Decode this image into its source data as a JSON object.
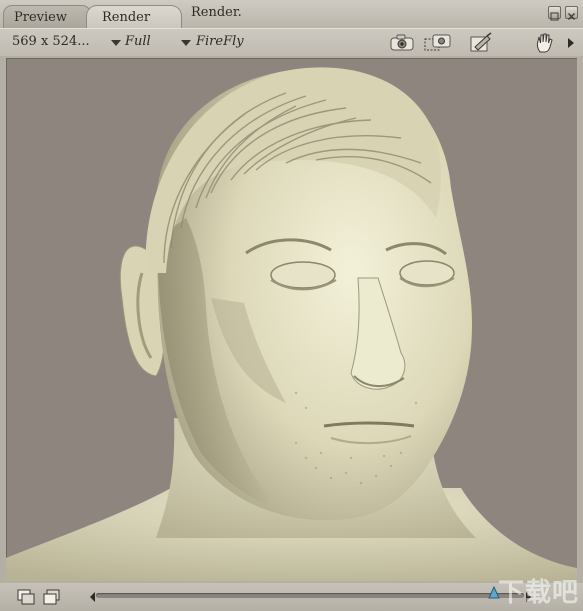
{
  "tabs": [
    {
      "label": "Preview",
      "active": false
    },
    {
      "label": "Render",
      "active": true
    }
  ],
  "document_title": "Render.",
  "toolbar": {
    "dimensions": "569 x 524...",
    "resolution_value": "Full",
    "renderer_value": "FireFly",
    "icons": [
      "render-camera-icon",
      "render-area-icon",
      "render-settings-icon",
      "hand-pan-icon",
      "play-arrow-icon"
    ]
  },
  "window_buttons": [
    "maximize-icon",
    "close-icon"
  ],
  "render": {
    "subject": "3D rendered male head bust"
  },
  "bottom": {
    "icons": [
      "save-render-icon",
      "load-render-icon"
    ],
    "slider_position": 0.93
  },
  "watermark": "下载吧",
  "colors": {
    "background": "#8f857f",
    "panel": "#c6c2b9",
    "skin": "#e7e4c6"
  }
}
